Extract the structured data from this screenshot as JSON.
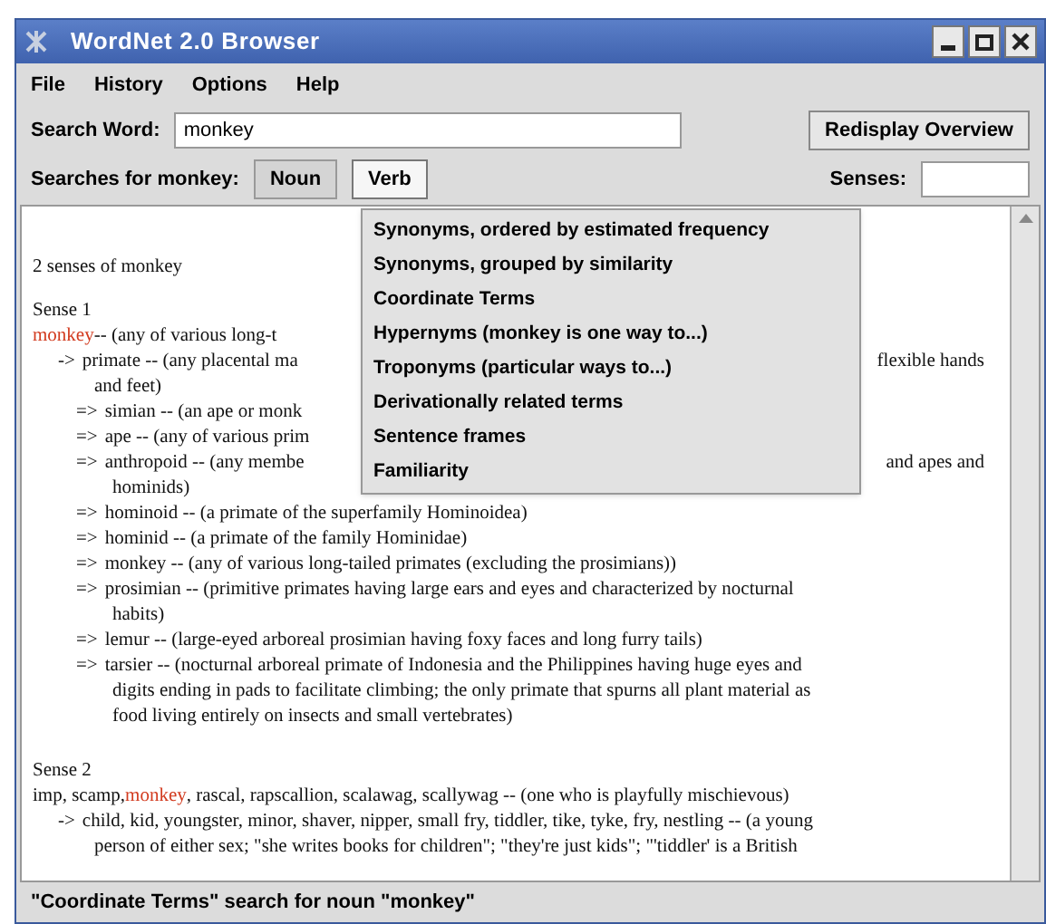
{
  "window": {
    "title": "WordNet 2.0 Browser"
  },
  "menu_bar": [
    "File",
    "History",
    "Options",
    "Help"
  ],
  "search": {
    "label": "Search Word:",
    "value": "monkey",
    "button": "Redisplay Overview"
  },
  "searches": {
    "label": "Searches for monkey:",
    "buttons": [
      {
        "label": "Noun",
        "selected": false
      },
      {
        "label": "Verb",
        "selected": true
      }
    ],
    "senses_label": "Senses:"
  },
  "dropdown": {
    "items": [
      "Synonyms, ordered by estimated frequency",
      "Synonyms, grouped by similarity",
      "Coordinate Terms",
      "Hypernyms (monkey is one way to...)",
      "Troponyms (particular ways to...)",
      "Derivationally related terms",
      "Sentence frames",
      "Familiarity"
    ]
  },
  "content": {
    "summary": "2 senses of monkey",
    "senses": [
      {
        "heading": "Sense 1",
        "entries": [
          {
            "lines": [
              {
                "segments": [
                  {
                    "text": "monkey",
                    "highlight": true
                  },
                  {
                    "text": " -- (any of various long-t",
                    "highlight": false
                  }
                ]
              }
            ],
            "children": [
              {
                "arrow": "->",
                "lines": [
                  {
                    "segments": [
                      {
                        "text": "primate -- (any placental ma",
                        "highlight": false
                      }
                    ],
                    "right": "flexible hands"
                  },
                  {
                    "segments": [
                      {
                        "text": "and feet)",
                        "highlight": false
                      }
                    ]
                  }
                ],
                "children": [
                  {
                    "arrow": "=>",
                    "lines": [
                      {
                        "segments": [
                          {
                            "text": "simian -- (an ape or monk",
                            "highlight": false
                          }
                        ]
                      }
                    ]
                  },
                  {
                    "arrow": "=>",
                    "lines": [
                      {
                        "segments": [
                          {
                            "text": "ape -- (any of various prim",
                            "highlight": false
                          }
                        ]
                      }
                    ]
                  },
                  {
                    "arrow": "=>",
                    "lines": [
                      {
                        "segments": [
                          {
                            "text": "anthropoid -- (any membe",
                            "highlight": false
                          }
                        ],
                        "right": "and apes and"
                      },
                      {
                        "segments": [
                          {
                            "text": "hominids)",
                            "highlight": false
                          }
                        ]
                      }
                    ]
                  },
                  {
                    "arrow": "=>",
                    "lines": [
                      {
                        "segments": [
                          {
                            "text": "hominoid -- (a primate of the superfamily Hominoidea)",
                            "highlight": false
                          }
                        ]
                      }
                    ]
                  },
                  {
                    "arrow": "=>",
                    "lines": [
                      {
                        "segments": [
                          {
                            "text": "hominid -- (a primate of the family Hominidae)",
                            "highlight": false
                          }
                        ]
                      }
                    ]
                  },
                  {
                    "arrow": "=>",
                    "lines": [
                      {
                        "segments": [
                          {
                            "text": "monkey -- (any of various long-tailed primates (excluding the prosimians))",
                            "highlight": false
                          }
                        ]
                      }
                    ]
                  },
                  {
                    "arrow": "=>",
                    "lines": [
                      {
                        "segments": [
                          {
                            "text": "prosimian -- (primitive primates having large ears and eyes and characterized by nocturnal",
                            "highlight": false
                          }
                        ]
                      },
                      {
                        "segments": [
                          {
                            "text": "habits)",
                            "highlight": false
                          }
                        ]
                      }
                    ]
                  },
                  {
                    "arrow": "=>",
                    "lines": [
                      {
                        "segments": [
                          {
                            "text": "lemur -- (large-eyed arboreal prosimian having foxy faces and long furry tails)",
                            "highlight": false
                          }
                        ]
                      }
                    ]
                  },
                  {
                    "arrow": "=>",
                    "lines": [
                      {
                        "segments": [
                          {
                            "text": "tarsier -- (nocturnal arboreal primate of Indonesia and the Philippines having huge eyes and",
                            "highlight": false
                          }
                        ]
                      },
                      {
                        "segments": [
                          {
                            "text": "digits ending in pads to facilitate climbing; the only primate that spurns all plant material as",
                            "highlight": false
                          }
                        ]
                      },
                      {
                        "segments": [
                          {
                            "text": "food living entirely on insects and small vertebrates)",
                            "highlight": false
                          }
                        ]
                      }
                    ]
                  }
                ]
              }
            ]
          }
        ]
      },
      {
        "heading": "Sense 2",
        "entries": [
          {
            "lines": [
              {
                "segments": [
                  {
                    "text": "imp, scamp, ",
                    "highlight": false
                  },
                  {
                    "text": "monkey",
                    "highlight": true
                  },
                  {
                    "text": ", rascal, rapscallion, scalawag, scallywag -- (one who is playfully mischievous)",
                    "highlight": false
                  }
                ]
              }
            ],
            "children": [
              {
                "arrow": "->",
                "lines": [
                  {
                    "segments": [
                      {
                        "text": "child, kid, youngster, minor, shaver, nipper, small fry, tiddler, tike, tyke, fry, nestling -- (a young",
                        "highlight": false
                      }
                    ]
                  },
                  {
                    "segments": [
                      {
                        "text": "person of either sex; \"she writes books for children\"; \"they're just kids\"; \"'tiddler' is a British",
                        "highlight": false
                      }
                    ]
                  }
                ]
              }
            ]
          }
        ]
      }
    ]
  },
  "status_bar": "\"Coordinate Terms\" search for noun \"monkey\""
}
